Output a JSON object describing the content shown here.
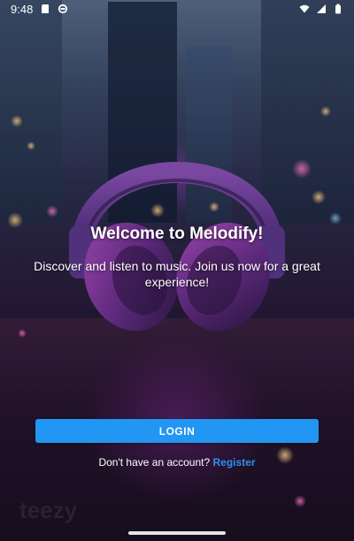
{
  "status_bar": {
    "time": "9:48",
    "icons_left": [
      "sd-card-icon",
      "sync-icon"
    ],
    "icons_right": [
      "wifi-icon",
      "signal-icon",
      "battery-icon"
    ]
  },
  "background": {
    "image": "headphones-on-wet-city-street",
    "accent_color": "#8a3fa6"
  },
  "welcome": {
    "title": "Welcome to Melodify!",
    "subtitle": "Discover and listen to music. Join us now for a great experience!"
  },
  "actions": {
    "login_label": "LOGIN",
    "login_color": "#2196f3",
    "register_prompt": "Don't have an account?",
    "register_link": "Register",
    "register_color": "#2e8ff0"
  },
  "watermark": {
    "text": "teezy"
  }
}
